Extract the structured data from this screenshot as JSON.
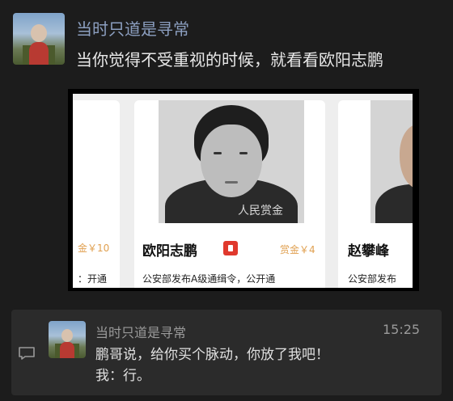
{
  "message": {
    "sender": "当时只道是寻常",
    "text": "当你觉得不受重视的时候，就看看欧阳志鹏",
    "image": {
      "watermark": "人民赏金",
      "cards": {
        "left": {
          "reward": "金￥10",
          "desc": "：开通"
        },
        "center": {
          "name": "欧阳志鹏",
          "reward": "赏金￥4",
          "desc": "公安部发布A级通缉令，公开通"
        },
        "right": {
          "name": "赵攀峰",
          "desc": "公安部发布"
        }
      }
    }
  },
  "quoted": {
    "sender": "当时只道是寻常",
    "time": "15:25",
    "line1": "鹏哥说，给你买个脉动，你放了我吧！",
    "line2": "我：行。"
  },
  "icons": [
    "avatar",
    "badge-icon",
    "quote-icon"
  ]
}
